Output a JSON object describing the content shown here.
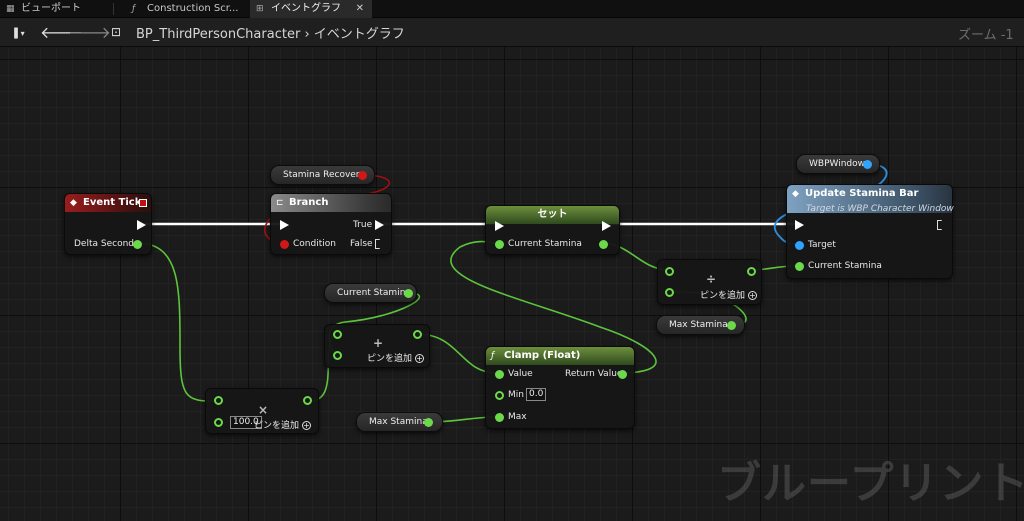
{
  "tabs": [
    {
      "label": "ビューポート",
      "icon": "viewport-icon"
    },
    {
      "label": "Construction Scr...",
      "icon": "function-icon"
    },
    {
      "label": "イベントグラフ",
      "icon": "event-graph-icon",
      "active": true
    }
  ],
  "toolbar": {
    "breadcrumb_root": "BP_ThirdPersonCharacter",
    "breadcrumb_sep": "›",
    "breadcrumb_current": "イベントグラフ",
    "zoom_label": "ズーム -1"
  },
  "nodes": {
    "event_tick": {
      "title": "Event Tick",
      "pin_delta": "Delta Seconds"
    },
    "branch": {
      "title": "Branch",
      "pin_true": "True",
      "pin_condition": "Condition",
      "pin_false": "False"
    },
    "set": {
      "title": "セット",
      "pin_in": "Current Stamina"
    },
    "update": {
      "title": "Update Stamina Bar",
      "subtitle": "Target is WBP Character Window",
      "pin_target": "Target",
      "pin_stamina": "Current Stamina"
    },
    "divide": {
      "op": "÷",
      "add_pin": "ピンを追加"
    },
    "add": {
      "op": "+",
      "add_pin": "ピンを追加"
    },
    "multiply": {
      "op": "×",
      "value": "100.0",
      "add_pin": "ピンを追加"
    },
    "clamp": {
      "title": "Clamp (Float)",
      "pin_value": "Value",
      "pin_return": "Return Value",
      "pin_min": "Min",
      "min_value": "0.0",
      "pin_max": "Max"
    }
  },
  "vars": {
    "stamina_recovery": "Stamina Recovery",
    "wbp_window": "WBPWindow",
    "current_stamina": "Current Stamina",
    "max_stamina_1": "Max Stamina",
    "max_stamina_2": "Max Stamina"
  },
  "watermark": "ブループリント",
  "colors": {
    "exec": "#ffffff",
    "float_pin": "#6bd94a",
    "bool_pin": "#d11717",
    "object_pin": "#2ea3ff"
  }
}
